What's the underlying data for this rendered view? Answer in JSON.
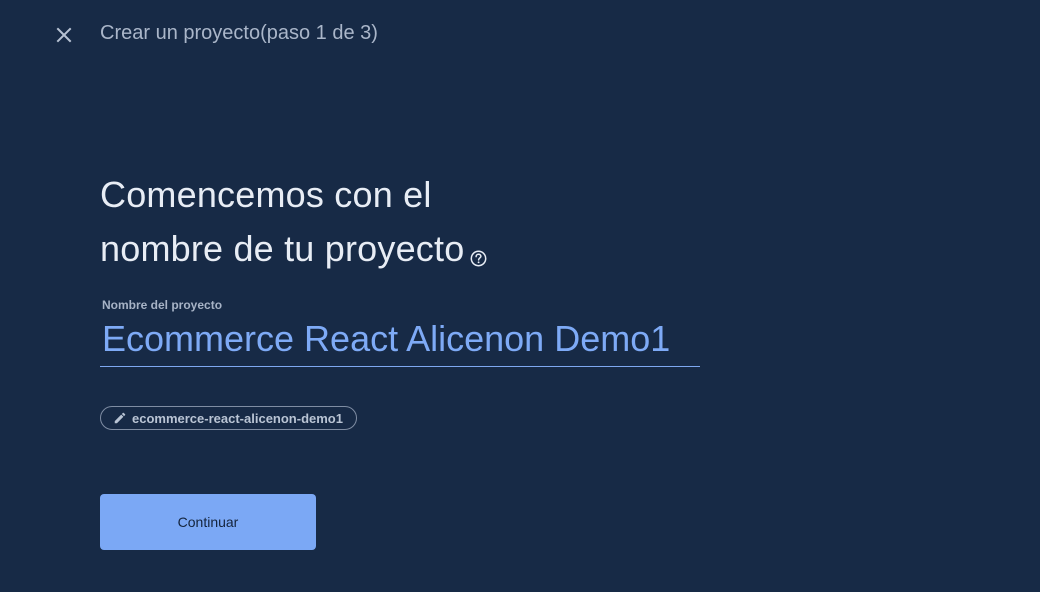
{
  "header": {
    "close_icon": "close-icon",
    "step_title": "Crear un proyecto(paso 1 de 3)"
  },
  "main": {
    "heading_line1": "Comencemos con el",
    "heading_line2": "nombre de tu proyecto",
    "help_icon": "help-circle-icon",
    "project_name": {
      "label": "Nombre del proyecto",
      "value": "Ecommerce React Alicenon Demo1"
    },
    "project_id": {
      "icon": "pencil-icon",
      "value": "ecommerce-react-alicenon-demo1"
    },
    "continue_label": "Continuar"
  },
  "colors": {
    "background": "#172a46",
    "accent": "#7ba8f5",
    "input_text": "#7eaaf6"
  }
}
